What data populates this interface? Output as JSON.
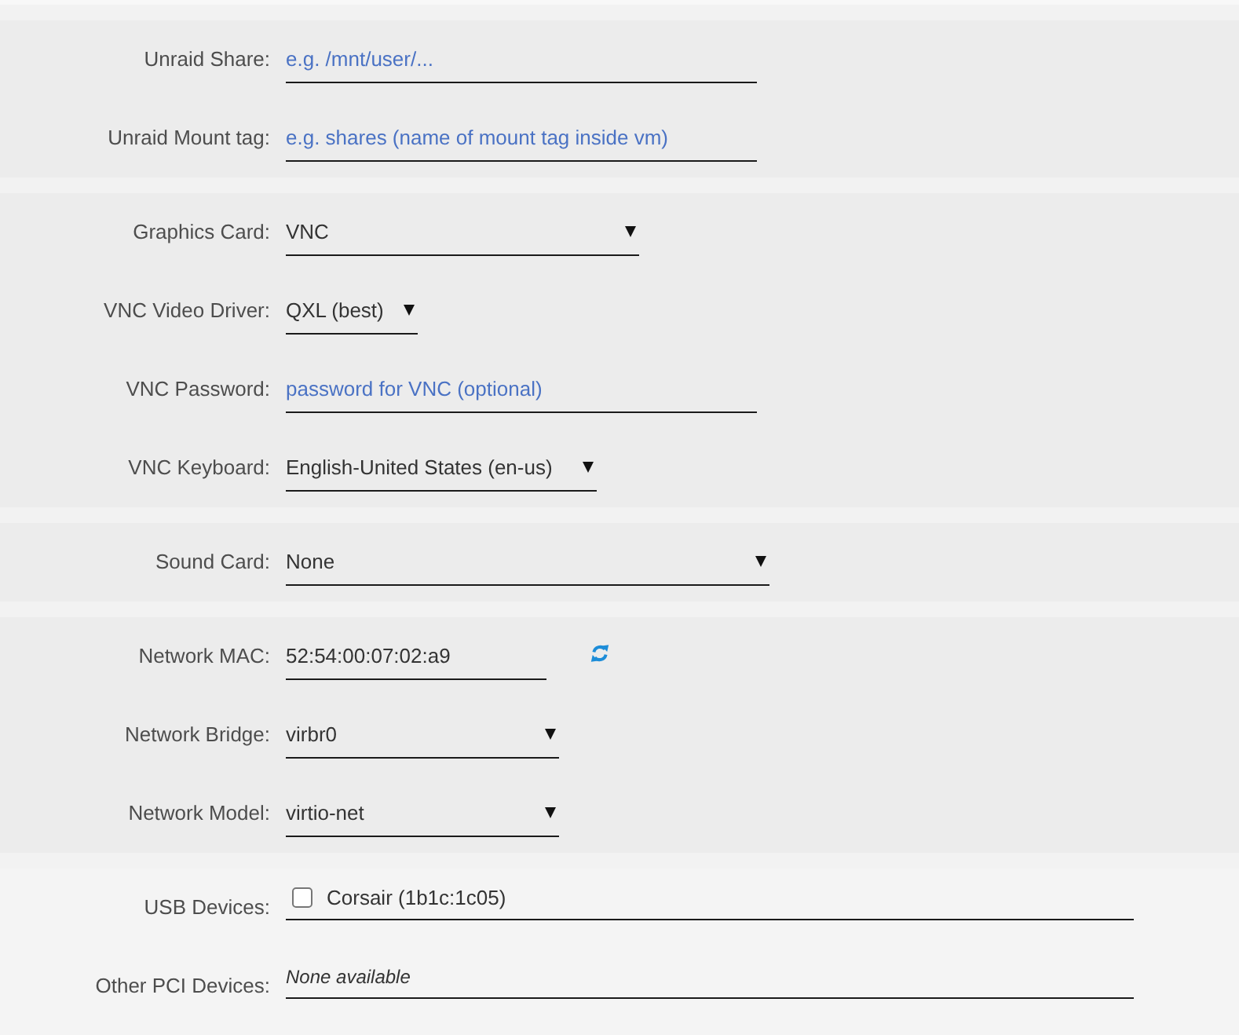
{
  "sections": [
    {
      "rows": [
        {
          "kind": "text",
          "label": "Unraid Share:",
          "placeholder": "e.g. /mnt/user/..."
        },
        {
          "kind": "text",
          "label": "Unraid Mount tag:",
          "placeholder": "e.g. shares (name of mount tag inside vm)"
        }
      ]
    },
    {
      "rows": [
        {
          "kind": "select",
          "label": "Graphics Card:",
          "value": "VNC"
        },
        {
          "kind": "select",
          "label": "VNC Video Driver:",
          "value": "QXL (best)"
        },
        {
          "kind": "text",
          "label": "VNC Password:",
          "placeholder": "password for VNC (optional)"
        },
        {
          "kind": "select",
          "label": "VNC Keyboard:",
          "value": "English-United States (en-us)"
        }
      ]
    },
    {
      "rows": [
        {
          "kind": "select",
          "label": "Sound Card:",
          "value": "None"
        }
      ]
    },
    {
      "rows": [
        {
          "kind": "mac",
          "label": "Network MAC:",
          "value": "52:54:00:07:02:a9"
        },
        {
          "kind": "select",
          "label": "Network Bridge:",
          "value": "virbr0"
        },
        {
          "kind": "select",
          "label": "Network Model:",
          "value": "virtio-net"
        }
      ]
    },
    {
      "rows": [
        {
          "kind": "checklist",
          "label": "USB Devices:",
          "options": [
            {
              "label": "Corsair (1b1c:1c05)",
              "checked": false
            }
          ]
        },
        {
          "kind": "note",
          "label": "Other PCI Devices:",
          "text": "None available"
        }
      ]
    }
  ]
}
